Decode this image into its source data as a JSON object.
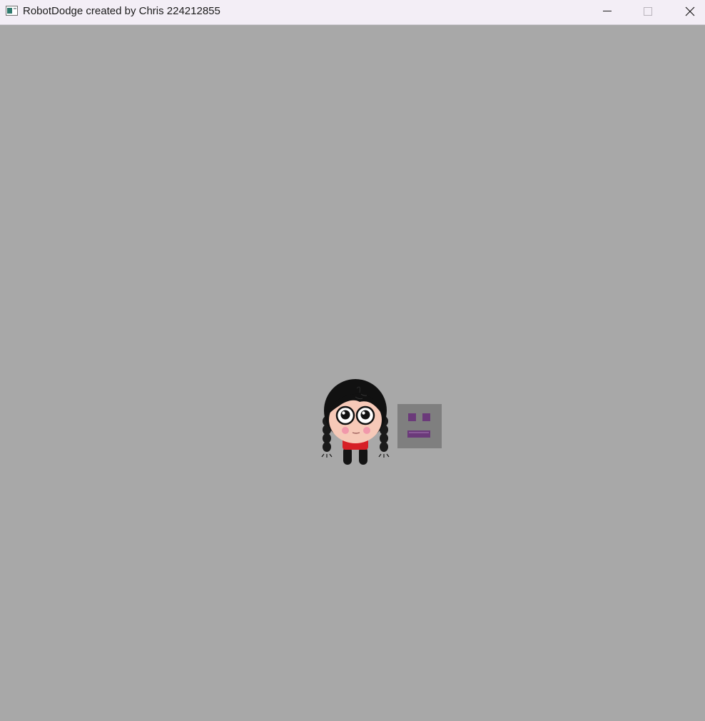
{
  "window": {
    "title": "RobotDodge created by Chris 224212855",
    "controls": {
      "minimize": "minimize-icon",
      "maximize": "maximize-icon",
      "close": "close-icon"
    }
  },
  "game": {
    "background_color": "#a8a8a8",
    "player": {
      "sprite": "girl-with-braids",
      "hair_color": "#111111",
      "skin_color": "#f6c9b8",
      "shirt_color": "#d61f26"
    },
    "robots": [
      {
        "sprite": "robot-square-face",
        "body_color": "#7f7f7f",
        "face_color": "#6b3a7a"
      }
    ]
  }
}
